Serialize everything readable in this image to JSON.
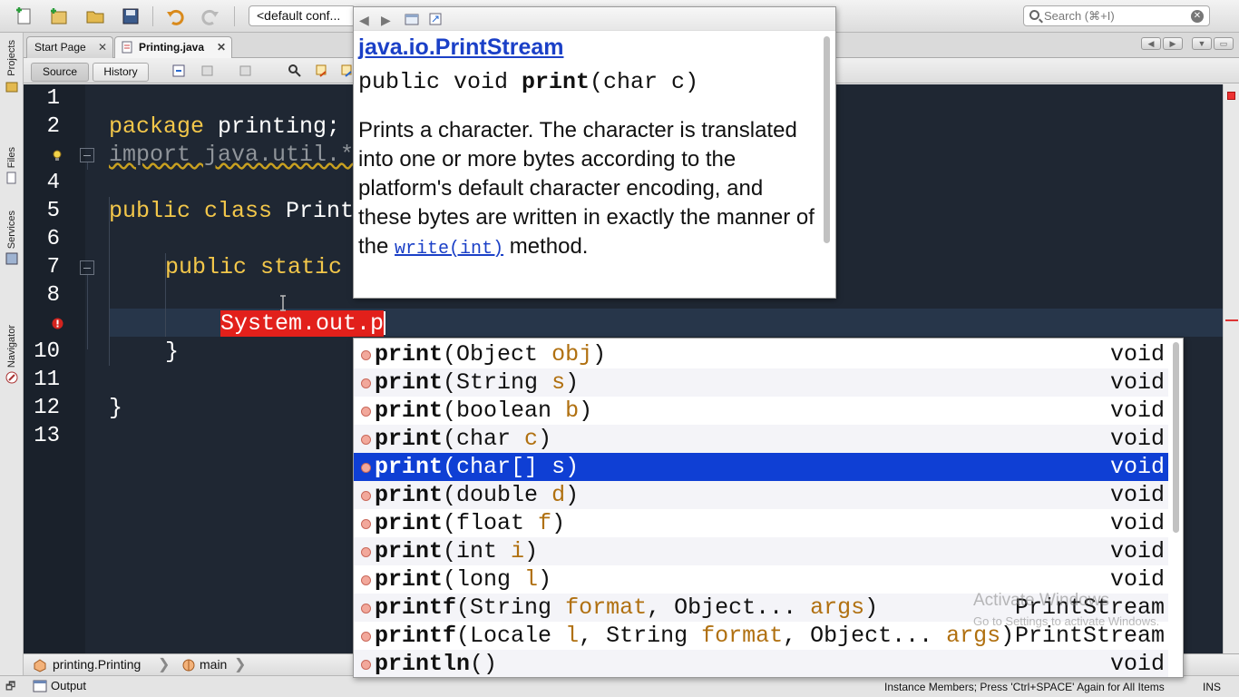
{
  "toolbar": {
    "config_value": "<default conf...",
    "search_placeholder": "Search (⌘+I)"
  },
  "left_strip": {
    "tabs": [
      "Projects",
      "Files",
      "Services",
      "Navigator"
    ]
  },
  "editor_tabs": [
    {
      "label": "Start Page"
    },
    {
      "label": "Printing.java"
    }
  ],
  "editor_toolbar": {
    "source_label": "Source",
    "history_label": "History"
  },
  "editor": {
    "line_numbers": [
      "1",
      "2",
      "",
      "4",
      "5",
      "6",
      "7",
      "8",
      "",
      "10",
      "11",
      "12",
      "13"
    ],
    "lines": {
      "l2_kw": "package",
      "l2_rest": " printing;",
      "l3": "import java.util.*",
      "l5_kw": "public class",
      "l5_rest": " Print",
      "l7_kw": "public static",
      "l9": "System.out.p",
      "l10": "}",
      "l12": "}"
    }
  },
  "javadoc": {
    "class_name": "java.io.PrintStream",
    "signature_pre": "public void ",
    "signature_name": "print",
    "signature_post": "(char c)",
    "description": "Prints a character. The character is translated into one or more bytes according to the platform's default character encoding, and these bytes are written in exactly the manner of the",
    "link_text": "write(int)",
    "description_end": " method."
  },
  "completion": {
    "items": [
      {
        "name": "print",
        "open": "(",
        "type1": "Object ",
        "p1": "obj",
        "close": ")",
        "ret": "void"
      },
      {
        "name": "print",
        "open": "(",
        "type1": "String ",
        "p1": "s",
        "close": ")",
        "ret": "void"
      },
      {
        "name": "print",
        "open": "(",
        "type1": "boolean ",
        "p1": "b",
        "close": ")",
        "ret": "void"
      },
      {
        "name": "print",
        "open": "(",
        "type1": "char ",
        "p1": "c",
        "close": ")",
        "ret": "void"
      },
      {
        "name": "print",
        "open": "(",
        "type1": "char[] ",
        "p1": "s",
        "close": ")",
        "ret": "void"
      },
      {
        "name": "print",
        "open": "(",
        "type1": "double ",
        "p1": "d",
        "close": ")",
        "ret": "void"
      },
      {
        "name": "print",
        "open": "(",
        "type1": "float ",
        "p1": "f",
        "close": ")",
        "ret": "void"
      },
      {
        "name": "print",
        "open": "(",
        "type1": "int ",
        "p1": "i",
        "close": ")",
        "ret": "void"
      },
      {
        "name": "print",
        "open": "(",
        "type1": "long ",
        "p1": "l",
        "close": ")",
        "ret": "void"
      },
      {
        "name": "printf",
        "open": "(",
        "type1": "String ",
        "p1": "format",
        "mid": ", Object... ",
        "p2": "args",
        "close": ")",
        "ret": "PrintStream"
      },
      {
        "name": "printf",
        "open": "(",
        "type1": "Locale ",
        "p1": "l",
        "mid": ", String ",
        "p2": "format",
        "mid2": ", Object... ",
        "p3": "args",
        "close": ")",
        "ret": "PrintStream"
      },
      {
        "name": "println",
        "open": "(",
        "type1": "",
        "p1": "",
        "close": ")",
        "ret": "void"
      }
    ],
    "selected_index": 4
  },
  "breadcrumbs": {
    "class": "printing.Printing",
    "method": "main"
  },
  "output_tab": "Output",
  "status": {
    "hint": "Instance Members; Press 'Ctrl+SPACE' Again for All Items",
    "mode": "INS"
  },
  "watermark": {
    "line1": "Activate Windows",
    "line2": "Go to Settings to activate Windows."
  },
  "colors": {
    "editor_bg": "#1f2733",
    "keyword": "#f3c74a",
    "selection": "#0f3fd4",
    "error_highlight": "#e2201b",
    "link": "#1b40c7"
  }
}
